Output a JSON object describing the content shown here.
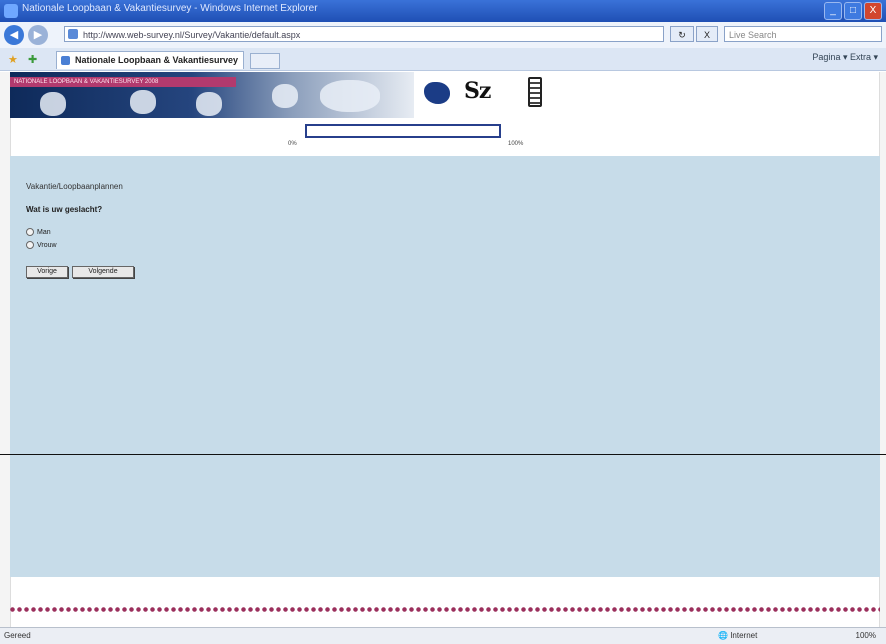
{
  "window": {
    "title": "Nationale Loopbaan & Vakantiesurvey - Windows Internet Explorer",
    "minimize": "_",
    "maximize": "□",
    "close": "X"
  },
  "navbar": {
    "back": "◀",
    "forward": "▶",
    "url": "http://www.web-survey.nl/Survey/Vakantie/default.aspx",
    "search_placeholder": "Live Search",
    "refresh": "↻",
    "stop": "X"
  },
  "tabs": [
    {
      "label": "Nationale Loopbaan & Vakantiesurvey"
    }
  ],
  "command_bar": "Pagina ▾   Extra ▾",
  "banner": {
    "strip_text": "NATIONALE LOOPBAAN & VAKANTIESURVEY 2008"
  },
  "progress": {
    "min_label": "0%",
    "max_label": "100%",
    "value_percent": 0
  },
  "question": {
    "heading": "Vakantie/Loopbaanplannen",
    "text": "Wat is uw geslacht?",
    "options": [
      "Man",
      "Vrouw"
    ]
  },
  "buttons": {
    "back": "Vorige",
    "next": "Volgende"
  },
  "statusbar": {
    "left": "Gereed",
    "zone": "Internet",
    "zoom": "100%"
  },
  "colors": {
    "content_bg": "#c7dce9",
    "accent": "#b23a6e",
    "brand": "#1b3c86"
  }
}
